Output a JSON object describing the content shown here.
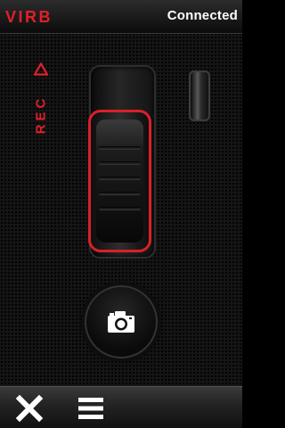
{
  "header": {
    "brand": "VIRB",
    "status": "Connected"
  },
  "record": {
    "label": "REC",
    "triangle_icon": "record-triangle-icon"
  },
  "controls": {
    "photo_icon": "camera-icon",
    "close_icon": "close-icon",
    "menu_icon": "hamburger-menu-icon"
  },
  "colors": {
    "accent_red": "#e0202a",
    "status_text": "#ffffff",
    "background": "#151515"
  }
}
